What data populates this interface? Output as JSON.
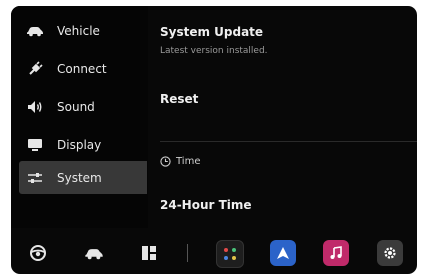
{
  "sidebar": {
    "items": [
      {
        "label": "Vehicle",
        "icon": "car-icon",
        "active": false
      },
      {
        "label": "Connect",
        "icon": "connect-plug-icon",
        "active": false
      },
      {
        "label": "Sound",
        "icon": "speaker-icon",
        "active": false
      },
      {
        "label": "Display",
        "icon": "monitor-icon",
        "active": false
      },
      {
        "label": "System",
        "icon": "sliders-icon",
        "active": true
      }
    ]
  },
  "main": {
    "system_update": {
      "title": "System Update",
      "status": "Latest version installed."
    },
    "reset": {
      "title": "Reset"
    },
    "time_section": {
      "heading": "Time",
      "icon": "clock-icon"
    },
    "time_format": {
      "title": "24-Hour Time"
    }
  },
  "dock": {
    "left": [
      {
        "icon": "steering-wheel-icon"
      },
      {
        "icon": "car-icon"
      },
      {
        "icon": "split-view-icon"
      }
    ],
    "apps": [
      {
        "icon": "app-grid-icon"
      },
      {
        "icon": "navigation-icon",
        "color": "#2b63c9"
      },
      {
        "icon": "music-icon",
        "color": "#c02a6a"
      },
      {
        "icon": "settings-gear-icon"
      }
    ]
  }
}
